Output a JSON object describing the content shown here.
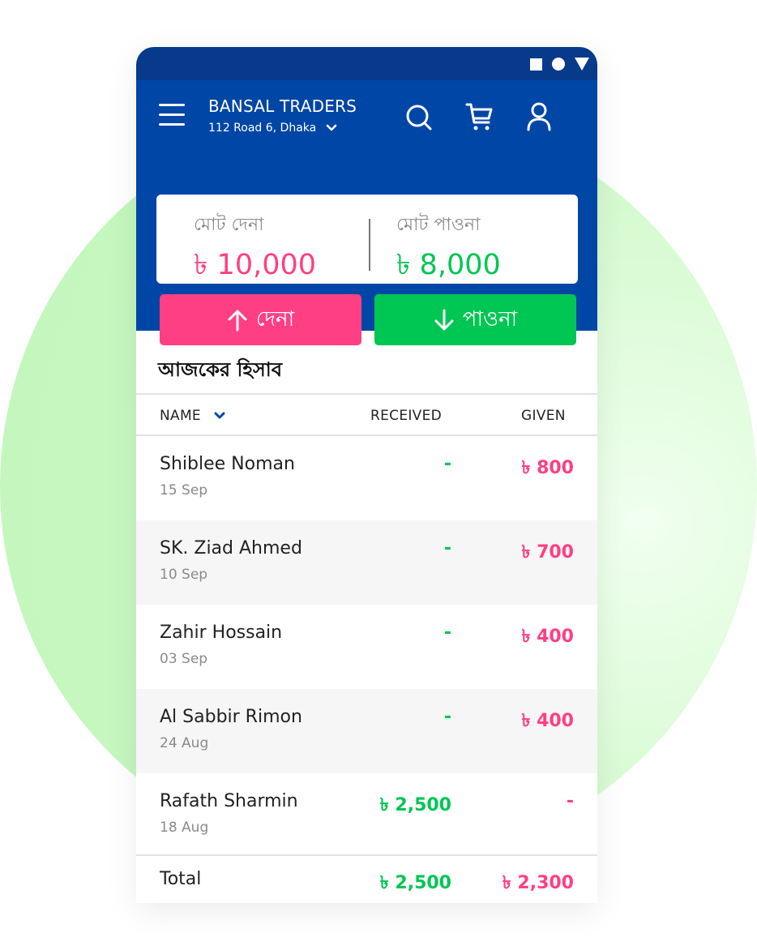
{
  "colors": {
    "primary": "#0046a6",
    "status_bar": "#073a8a",
    "pink": "#ff3f83",
    "green": "#00c653"
  },
  "header": {
    "title": "BANSAL TRADERS",
    "address": "112 Road 6, Dhaka"
  },
  "summary": {
    "give_label": "মোট দেনা",
    "give_value": "৳ 10,000",
    "get_label": "মোট পাওনা",
    "get_value": "৳ 8,000"
  },
  "actions": {
    "give_label": "দেনা",
    "get_label": "পাওনা"
  },
  "section_title": "আজকের হিসাব",
  "table": {
    "columns": [
      "NAME",
      "RECEIVED",
      "GIVEN"
    ],
    "rows": [
      {
        "name": "Shiblee Noman",
        "date": "15 Sep",
        "received": "-",
        "given": "৳ 800"
      },
      {
        "name": "SK. Ziad Ahmed",
        "date": "10 Sep",
        "received": "-",
        "given": "৳ 700"
      },
      {
        "name": "Zahir Hossain",
        "date": "03 Sep",
        "received": "-",
        "given": "৳ 400"
      },
      {
        "name": "Al Sabbir Rimon",
        "date": "24 Aug",
        "received": "-",
        "given": "৳ 400"
      },
      {
        "name": "Rafath Sharmin",
        "date": "18 Aug",
        "received": "৳ 2,500",
        "given": "-"
      }
    ],
    "total": {
      "label": "Total",
      "received": "৳ 2,500",
      "given": "৳ 2,300"
    }
  }
}
